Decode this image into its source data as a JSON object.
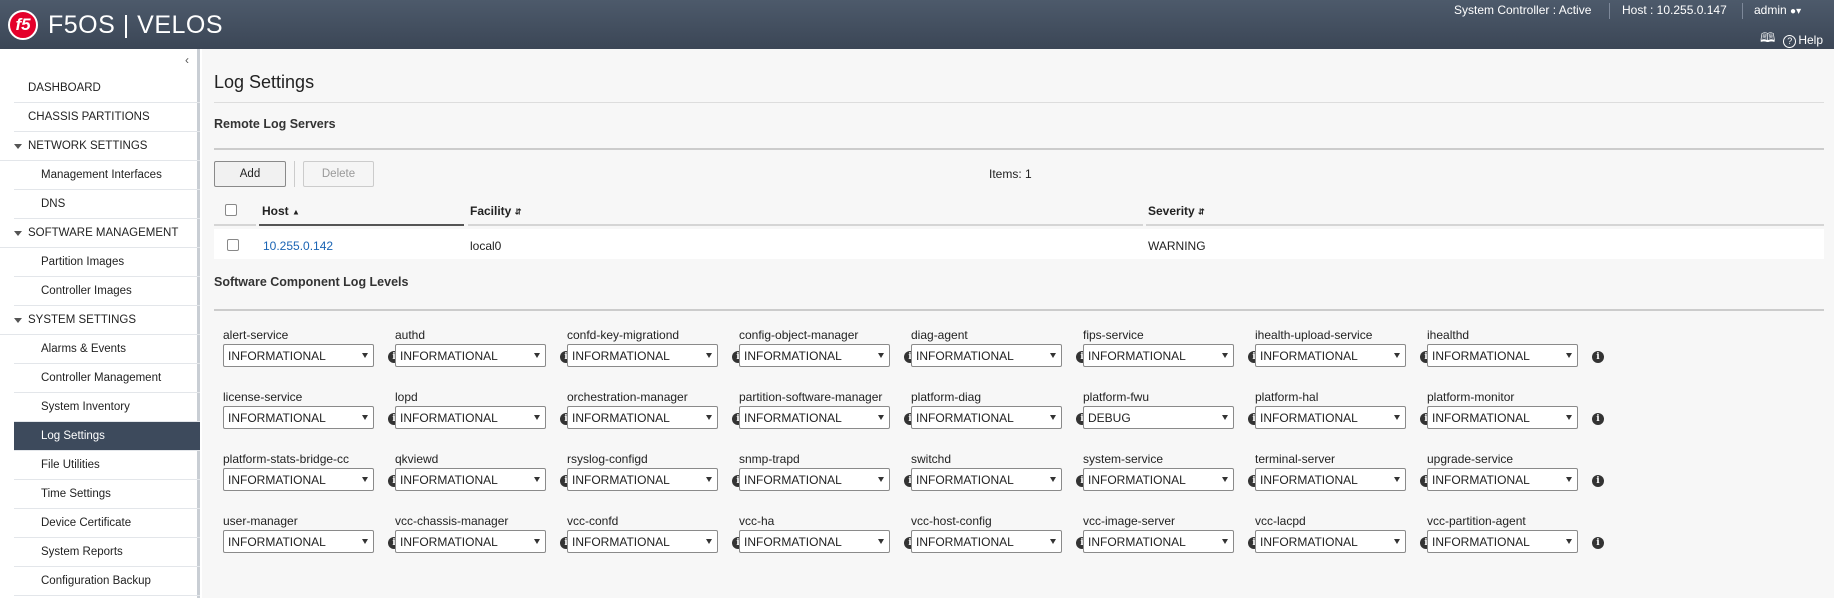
{
  "header": {
    "brand": "F5OS | VELOS",
    "logo_text": "f5",
    "system_controller": "System Controller : Active",
    "host": "Host : 10.255.0.147",
    "user": "admin",
    "help": "Help",
    "accent_color": "#e4002b"
  },
  "sidebar": {
    "items": [
      {
        "label": "DASHBOARD"
      },
      {
        "label": "CHASSIS PARTITIONS"
      },
      {
        "label": "NETWORK SETTINGS"
      },
      {
        "label": "Management Interfaces"
      },
      {
        "label": "DNS"
      },
      {
        "label": "SOFTWARE MANAGEMENT"
      },
      {
        "label": "Partition Images"
      },
      {
        "label": "Controller Images"
      },
      {
        "label": "SYSTEM SETTINGS"
      },
      {
        "label": "Alarms & Events"
      },
      {
        "label": "Controller Management"
      },
      {
        "label": "System Inventory"
      },
      {
        "label": "Log Settings"
      },
      {
        "label": "File Utilities"
      },
      {
        "label": "Time Settings"
      },
      {
        "label": "Device Certificate"
      },
      {
        "label": "System Reports"
      },
      {
        "label": "Configuration Backup"
      }
    ]
  },
  "main": {
    "title": "Log Settings",
    "remote_section": "Remote Log Servers",
    "add_label": "Add",
    "delete_label": "Delete",
    "items_count": "Items: 1",
    "columns": [
      "Host",
      "Facility",
      "Severity"
    ],
    "rows": [
      {
        "host": "10.255.0.142",
        "facility": "local0",
        "severity": "WARNING"
      }
    ],
    "components_section": "Software Component Log Levels",
    "components": [
      {
        "name": "alert-service",
        "level": "INFORMATIONAL"
      },
      {
        "name": "authd",
        "level": "INFORMATIONAL"
      },
      {
        "name": "confd-key-migrationd",
        "level": "INFORMATIONAL"
      },
      {
        "name": "config-object-manager",
        "level": "INFORMATIONAL"
      },
      {
        "name": "diag-agent",
        "level": "INFORMATIONAL"
      },
      {
        "name": "fips-service",
        "level": "INFORMATIONAL"
      },
      {
        "name": "ihealth-upload-service",
        "level": "INFORMATIONAL"
      },
      {
        "name": "ihealthd",
        "level": "INFORMATIONAL"
      },
      {
        "name": "license-service",
        "level": "INFORMATIONAL"
      },
      {
        "name": "lopd",
        "level": "INFORMATIONAL"
      },
      {
        "name": "orchestration-manager",
        "level": "INFORMATIONAL"
      },
      {
        "name": "partition-software-manager",
        "level": "INFORMATIONAL"
      },
      {
        "name": "platform-diag",
        "level": "INFORMATIONAL"
      },
      {
        "name": "platform-fwu",
        "level": "DEBUG"
      },
      {
        "name": "platform-hal",
        "level": "INFORMATIONAL"
      },
      {
        "name": "platform-monitor",
        "level": "INFORMATIONAL"
      },
      {
        "name": "platform-stats-bridge-cc",
        "level": "INFORMATIONAL"
      },
      {
        "name": "qkviewd",
        "level": "INFORMATIONAL"
      },
      {
        "name": "rsyslog-configd",
        "level": "INFORMATIONAL"
      },
      {
        "name": "snmp-trapd",
        "level": "INFORMATIONAL"
      },
      {
        "name": "switchd",
        "level": "INFORMATIONAL"
      },
      {
        "name": "system-service",
        "level": "INFORMATIONAL"
      },
      {
        "name": "terminal-server",
        "level": "INFORMATIONAL"
      },
      {
        "name": "upgrade-service",
        "level": "INFORMATIONAL"
      },
      {
        "name": "user-manager",
        "level": "INFORMATIONAL"
      },
      {
        "name": "vcc-chassis-manager",
        "level": "INFORMATIONAL"
      },
      {
        "name": "vcc-confd",
        "level": "INFORMATIONAL"
      },
      {
        "name": "vcc-ha",
        "level": "INFORMATIONAL"
      },
      {
        "name": "vcc-host-config",
        "level": "INFORMATIONAL"
      },
      {
        "name": "vcc-image-server",
        "level": "INFORMATIONAL"
      },
      {
        "name": "vcc-lacpd",
        "level": "INFORMATIONAL"
      },
      {
        "name": "vcc-partition-agent",
        "level": "INFORMATIONAL"
      }
    ]
  }
}
